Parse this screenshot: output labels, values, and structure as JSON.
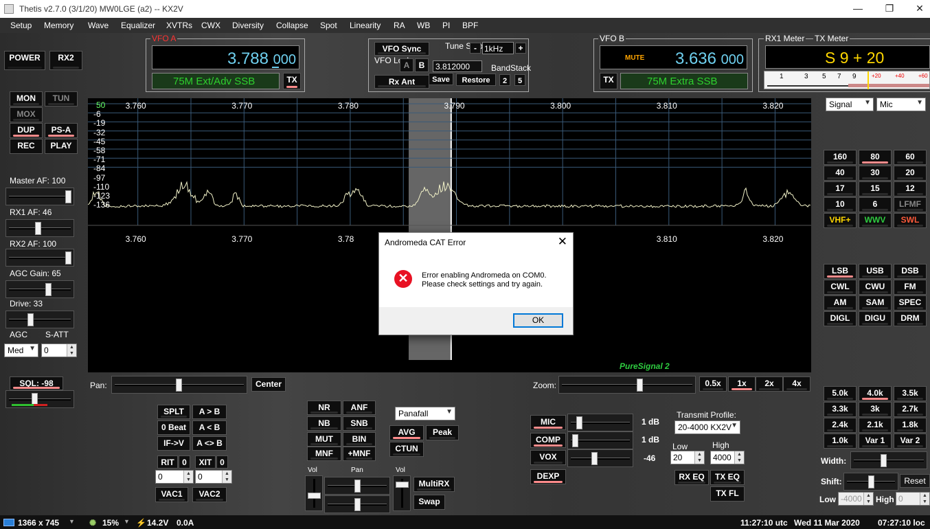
{
  "title_bar": {
    "title": "Thetis v2.7.0 (3/1/20) MW0LGE (a2)   --   KX2V",
    "minimize": "—",
    "maximize": "❐",
    "close": "✕"
  },
  "menu": [
    "Setup",
    "Memory",
    "Wave",
    "Equalizer",
    "XVTRs",
    "CWX",
    "Diversity",
    "Collapse",
    "Spot",
    "Linearity",
    "RA",
    "WB",
    "PI",
    "BPF"
  ],
  "left_buttons": {
    "power": "POWER",
    "rx2": "RX2",
    "mon": "MON",
    "tun": "TUN",
    "mox": "MOX",
    "dup": "DUP",
    "psa": "PS-A",
    "rec": "REC",
    "play": "PLAY"
  },
  "left_controls": {
    "master_af": "Master AF:  100",
    "rx1_af": "RX1 AF:  46",
    "rx2_af": "RX2 AF:  100",
    "agc_gain": "AGC Gain:  65",
    "drive": "Drive:  33",
    "agc_label": "AGC",
    "satt_label": "S-ATT",
    "agc_value": "Med",
    "satt_value": "0",
    "sql": "SQL: -98"
  },
  "slider_levels": {
    "master_af": 100,
    "rx1_af": 46,
    "rx2_af": 100,
    "agc_gain": 65,
    "drive": 33,
    "sql": 0.4
  },
  "vfo_a": {
    "label": "VFO A",
    "freq_main": "3.788",
    "freq_sub": "000",
    "mode": "75M Ext/Adv SSB",
    "tx": "TX"
  },
  "vfo_center": {
    "vfo_sync": "VFO Sync",
    "tune_step_label": "Tune Step:",
    "tune_minus": "-",
    "tune_step": "1kHz",
    "tune_plus": "+",
    "vfo_lock": "VFO Lock:",
    "lock_a": "A",
    "lock_b": "B",
    "memory_freq": "3.812000",
    "bandstack": "BandStack",
    "rx_ant": "Rx Ant",
    "save": "Save",
    "restore": "Restore",
    "bs_num": "2",
    "bs_total": "5"
  },
  "vfo_b": {
    "label": "VFO B",
    "mute": "MUTE",
    "freq_main": "3.636",
    "freq_sub": "000",
    "mode": "75M Extra SSB",
    "tx": "TX"
  },
  "meter": {
    "rx1_label": "RX1 Meter",
    "tx_label": "TX Meter",
    "reading": "S 9 + 20",
    "scale": [
      "1",
      "3",
      "5",
      "7",
      "9",
      "+20",
      "+40",
      "+60"
    ],
    "rx_select": "Signal",
    "tx_select": "Mic"
  },
  "spectrum": {
    "freq_ticks": [
      "3.760",
      "3.770",
      "3.780",
      "3.790",
      "3.800",
      "3.810",
      "3.820"
    ],
    "freq_ticks_lower": [
      "3.760",
      "3.770",
      "3.78",
      "",
      "3.800",
      "3.810",
      "3.820"
    ],
    "db_ticks": [
      "50",
      "-6",
      "-19",
      "-32",
      "-45",
      "-58",
      "-71",
      "-84",
      "-97",
      "-110",
      "-123",
      "-136"
    ],
    "puresignal": "PureSignal 2"
  },
  "bands": [
    "160",
    "80",
    "60",
    "40",
    "30",
    "20",
    "17",
    "15",
    "12",
    "10",
    "6",
    "LFMF",
    "VHF+",
    "WWV",
    "SWL"
  ],
  "modes": [
    "LSB",
    "USB",
    "DSB",
    "CWL",
    "CWU",
    "FM",
    "AM",
    "SAM",
    "SPEC",
    "DIGL",
    "DIGU",
    "DRM"
  ],
  "filters": [
    "5.0k",
    "4.0k",
    "3.5k",
    "3.3k",
    "3k",
    "2.7k",
    "2.4k",
    "2.1k",
    "1.8k",
    "1.0k",
    "Var 1",
    "Var 2"
  ],
  "filter_controls": {
    "width": "Width:",
    "shift": "Shift:",
    "reset": "Reset",
    "low": "Low",
    "low_value": "-4000",
    "high": "High",
    "high_value": "0"
  },
  "pan": {
    "label": "Pan:",
    "center": "Center",
    "zoom": "Zoom:",
    "zoom_opts": [
      "0.5x",
      "1x",
      "2x",
      "4x"
    ]
  },
  "vfo_ops": {
    "splt": "SPLT",
    "a_to_b": "A > B",
    "zero_beat": "0 Beat",
    "b_to_a": "A < B",
    "if_v": "IF->V",
    "swap": "A <> B",
    "rit": "RIT",
    "rit_val": "0",
    "xit": "XIT",
    "xit_val": "0",
    "rit_spin": "0",
    "xit_spin": "0",
    "vac1": "VAC1",
    "vac2": "VAC2"
  },
  "dsp": {
    "nr": "NR",
    "anf": "ANF",
    "nb": "NB",
    "snb": "SNB",
    "mut": "MUT",
    "bin": "BIN",
    "mnf": "MNF",
    "plus_mnf": "+MNF",
    "display_mode": "Panafall",
    "avg": "AVG",
    "peak": "Peak",
    "ctun": "CTUN",
    "vol": "Vol",
    "pan": "Pan",
    "vol2": "Vol",
    "multirx": "MultiRX",
    "swap": "Swap"
  },
  "tx_controls": {
    "mic": "MIC",
    "mic_db": "1 dB",
    "comp": "COMP",
    "comp_db": "1 dB",
    "vox": "VOX",
    "vox_val": "-46",
    "dexp": "DEXP",
    "tx_profile_label": "Transmit Profile:",
    "tx_profile": "20-4000 KX2V",
    "low_label": "Low",
    "low_val": "20",
    "high_label": "High",
    "high_val": "4000",
    "rx_eq": "RX EQ",
    "tx_eq": "TX EQ",
    "tx_fl": "TX FL"
  },
  "dialog": {
    "title": "Andromeda CAT Error",
    "close": "✕",
    "line1": "Error enabling Andromeda on COM0.",
    "line2": "Please check settings and try again.",
    "ok": "OK",
    "icon": "✕"
  },
  "status": {
    "resolution": "1366 x 745",
    "cpu": "15%",
    "voltage": "14.2V",
    "current": "0.0A",
    "utc": "11:27:10 utc",
    "date": "Wed 11 Mar 2020",
    "local": "07:27:10 loc"
  }
}
